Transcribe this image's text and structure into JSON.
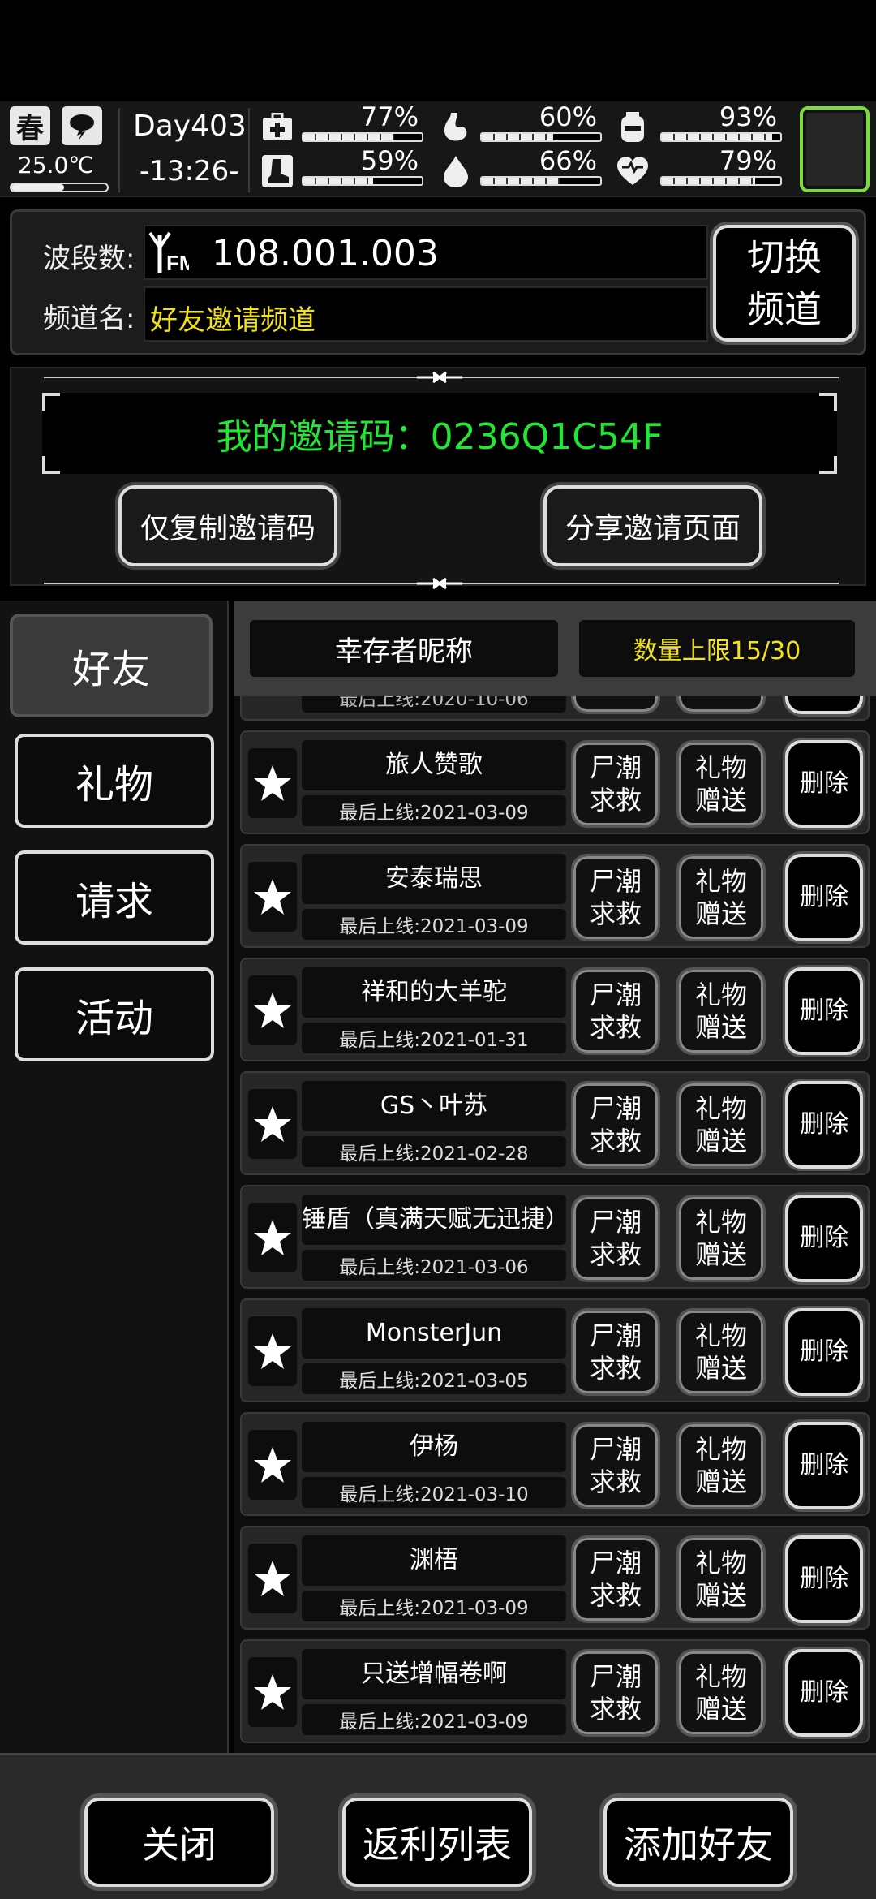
{
  "status": {
    "season": "春",
    "weather_icon": "storm-cloud-icon",
    "temperature": "25.0℃",
    "temperature_level": 0.55,
    "day": "Day403",
    "time": "-13:26-",
    "stats": [
      {
        "icon": "medkit-icon",
        "percent": "77%",
        "value": 0.77
      },
      {
        "icon": "stomach-icon",
        "percent": "60%",
        "value": 0.6
      },
      {
        "icon": "water-bottle-icon",
        "percent": "93%",
        "value": 0.93
      },
      {
        "icon": "boot-icon",
        "percent": "59%",
        "value": 0.59
      },
      {
        "icon": "water-drop-icon",
        "percent": "66%",
        "value": 0.66
      },
      {
        "icon": "heart-icon",
        "percent": "79%",
        "value": 0.79
      }
    ]
  },
  "radio": {
    "band_label": "波段数:",
    "fm": "FM",
    "frequency": "108.001.003",
    "channel_label": "频道名:",
    "channel_name": "好友邀请频道",
    "switch_label": "切换频道"
  },
  "invite": {
    "code_text": "我的邀请码：0236Q1C54F",
    "copy_label": "仅复制邀请码",
    "share_label": "分享邀请页面"
  },
  "tabs": [
    {
      "label": "好友",
      "active": true
    },
    {
      "label": "礼物",
      "active": false
    },
    {
      "label": "请求",
      "active": false
    },
    {
      "label": "活动",
      "active": false
    }
  ],
  "list": {
    "header_name": "幸存者昵称",
    "header_count": "数量上限15/30",
    "partial_last_seen": "最后上线:2020-10-06",
    "help_label": "尸潮求救",
    "gift_label": "礼物赠送",
    "delete_label": "删除",
    "friends": [
      {
        "name": "旅人赞歌",
        "last_seen": "最后上线:2021-03-09"
      },
      {
        "name": "安泰瑞思",
        "last_seen": "最后上线:2021-03-09"
      },
      {
        "name": "祥和的大羊驼",
        "last_seen": "最后上线:2021-01-31"
      },
      {
        "name": "GS丶叶苏",
        "last_seen": "最后上线:2021-02-28"
      },
      {
        "name": "锤盾（真满天赋无迅捷）",
        "last_seen": "最后上线:2021-03-06"
      },
      {
        "name": "MonsterJun",
        "last_seen": "最后上线:2021-03-05"
      },
      {
        "name": "伊杨",
        "last_seen": "最后上线:2021-03-10"
      },
      {
        "name": "渊梧",
        "last_seen": "最后上线:2021-03-09"
      },
      {
        "name": "只送增幅卷啊",
        "last_seen": "最后上线:2021-03-09"
      }
    ]
  },
  "bottom": {
    "close_label": "关闭",
    "rebate_label": "返利列表",
    "add_friend_label": "添加好友"
  },
  "colors": {
    "code_green": "#22e633",
    "channel_yellow": "#f2e21b",
    "accent_green_border": "#7ddc3c"
  }
}
